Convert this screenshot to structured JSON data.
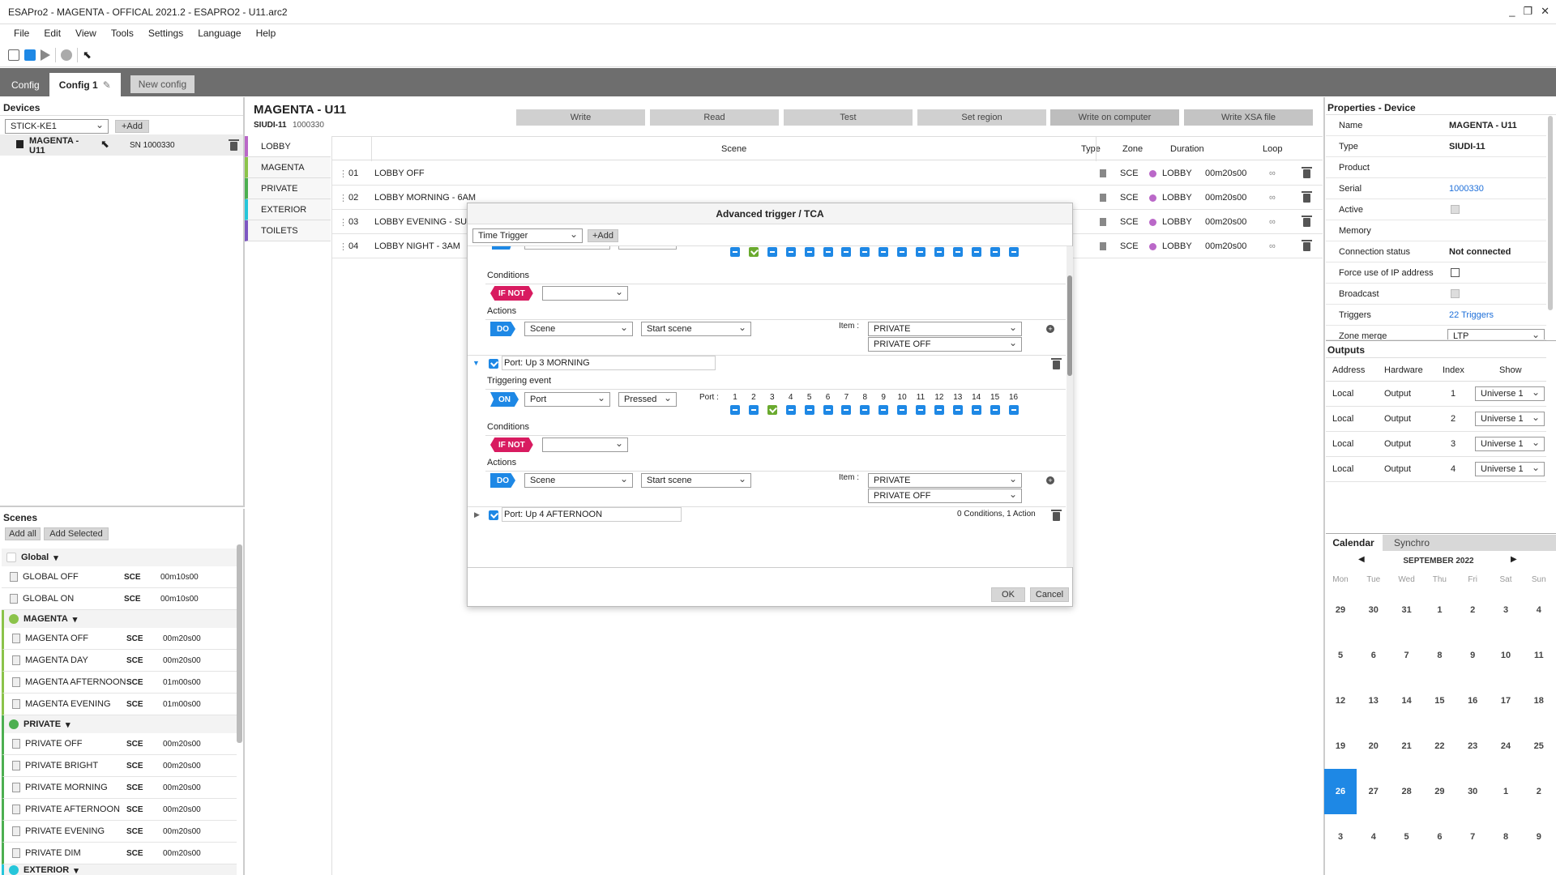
{
  "window": {
    "title": "ESAPro2 - MAGENTA - OFFICAL 2021.2 - ESAPRO2 - U11.arc2",
    "controls": [
      "_",
      "❐",
      "✕"
    ]
  },
  "menu": [
    "File",
    "Edit",
    "View",
    "Tools",
    "Settings",
    "Language",
    "Help"
  ],
  "tabs": {
    "config": "Config",
    "config1": "Config 1",
    "new_config": "New config"
  },
  "devices": {
    "title": "Devices",
    "stick": "STICK-KE1",
    "add": "Add",
    "device": {
      "name_line1": "MAGENTA -",
      "name_line2": "U11",
      "sn": "SN 1000330"
    }
  },
  "scenes": {
    "title": "Scenes",
    "add_all": "Add all",
    "add_selected": "Add Selected",
    "groups": [
      {
        "name": "Global",
        "color": "#ffffff",
        "items": [
          {
            "name": "GLOBAL OFF",
            "type": "SCE",
            "dur": "00m10s00"
          },
          {
            "name": "GLOBAL ON",
            "type": "SCE",
            "dur": "00m10s00"
          }
        ]
      },
      {
        "name": "MAGENTA",
        "color": "#8bc34a",
        "items": [
          {
            "name": "MAGENTA OFF",
            "type": "SCE",
            "dur": "00m20s00"
          },
          {
            "name": "MAGENTA DAY",
            "type": "SCE",
            "dur": "00m20s00"
          },
          {
            "name": "MAGENTA AFTERNOON",
            "type": "SCE",
            "dur": "01m00s00"
          },
          {
            "name": "MAGENTA EVENING",
            "type": "SCE",
            "dur": "01m00s00"
          }
        ]
      },
      {
        "name": "PRIVATE",
        "color": "#4caf50",
        "items": [
          {
            "name": "PRIVATE OFF",
            "type": "SCE",
            "dur": "00m20s00"
          },
          {
            "name": "PRIVATE BRIGHT",
            "type": "SCE",
            "dur": "00m20s00"
          },
          {
            "name": "PRIVATE MORNING",
            "type": "SCE",
            "dur": "00m20s00"
          },
          {
            "name": "PRIVATE AFTERNOON",
            "type": "SCE",
            "dur": "00m20s00"
          },
          {
            "name": "PRIVATE EVENING",
            "type": "SCE",
            "dur": "00m20s00"
          },
          {
            "name": "PRIVATE DIM",
            "type": "SCE",
            "dur": "00m20s00"
          }
        ]
      },
      {
        "name": "EXTERIOR",
        "color": "#26c6da",
        "items": []
      }
    ]
  },
  "device_header": {
    "title": "MAGENTA - U11",
    "model": "SIUDI-11",
    "serial": "1000330"
  },
  "actions": [
    "Write",
    "Read",
    "Test",
    "Set region",
    "Write on computer",
    "Write XSA file"
  ],
  "zones": [
    {
      "name": "LOBBY",
      "color": "#ba68c8"
    },
    {
      "name": "MAGENTA",
      "color": "#8bc34a"
    },
    {
      "name": "PRIVATE",
      "color": "#4caf50"
    },
    {
      "name": "EXTERIOR",
      "color": "#26c6da"
    },
    {
      "name": "TOILETS",
      "color": "#7e57c2"
    }
  ],
  "grid": {
    "headers": {
      "scene": "Scene",
      "type": "Type",
      "zone": "Zone",
      "duration": "Duration",
      "loop": "Loop"
    },
    "rows": [
      {
        "num": "01",
        "name": "LOBBY OFF",
        "type": "SCE",
        "zone": "LOBBY",
        "dur": "00m20s00"
      },
      {
        "num": "02",
        "name": "LOBBY MORNING - 6AM",
        "type": "SCE",
        "zone": "LOBBY",
        "dur": "00m20s00"
      },
      {
        "num": "03",
        "name": "LOBBY EVENING - SUN",
        "type": "SCE",
        "zone": "LOBBY",
        "dur": "00m20s00"
      },
      {
        "num": "04",
        "name": "LOBBY NIGHT - 3AM",
        "type": "SCE",
        "zone": "LOBBY",
        "dur": "00m20s00"
      }
    ]
  },
  "properties": {
    "title": "Properties - Device",
    "rows": [
      {
        "k": "Name",
        "v": "MAGENTA - U11"
      },
      {
        "k": "Type",
        "v": "SIUDI-11"
      },
      {
        "k": "Product",
        "v": ""
      },
      {
        "k": "Serial",
        "v": "1000330"
      },
      {
        "k": "Active",
        "v": ""
      },
      {
        "k": "Memory",
        "v": ""
      },
      {
        "k": "Connection status",
        "v": "Not connected"
      },
      {
        "k": "Force use of IP address",
        "v": ""
      },
      {
        "k": "Broadcast",
        "v": ""
      },
      {
        "k": "Triggers",
        "v": "22 Triggers"
      },
      {
        "k": "Zone merge",
        "v": "LTP"
      }
    ]
  },
  "outputs": {
    "title": "Outputs",
    "headers": [
      "Address",
      "Hardware",
      "Index",
      "Show"
    ],
    "rows": [
      {
        "addr": "Local",
        "hw": "Output",
        "idx": "1",
        "show": "Universe 1"
      },
      {
        "addr": "Local",
        "hw": "Output",
        "idx": "2",
        "show": "Universe 1"
      },
      {
        "addr": "Local",
        "hw": "Output",
        "idx": "3",
        "show": "Universe 1"
      },
      {
        "addr": "Local",
        "hw": "Output",
        "idx": "4",
        "show": "Universe 1"
      }
    ]
  },
  "calendar": {
    "tab_calendar": "Calendar",
    "tab_synchro": "Synchro",
    "month": "SEPTEMBER 2022",
    "weekdays": [
      "Mon",
      "Tue",
      "Wed",
      "Thu",
      "Fri",
      "Sat",
      "Sun"
    ],
    "weeks": [
      [
        "29",
        "30",
        "31",
        "1",
        "2",
        "3",
        "4"
      ],
      [
        "5",
        "6",
        "7",
        "8",
        "9",
        "10",
        "11"
      ],
      [
        "12",
        "13",
        "14",
        "15",
        "16",
        "17",
        "18"
      ],
      [
        "19",
        "20",
        "21",
        "22",
        "23",
        "24",
        "25"
      ],
      [
        "26",
        "27",
        "28",
        "29",
        "30",
        "1",
        "2"
      ],
      [
        "3",
        "4",
        "5",
        "6",
        "7",
        "8",
        "9"
      ]
    ],
    "selected": "26"
  },
  "modal": {
    "title": "Advanced trigger / TCA",
    "trigger_type": "Time Trigger",
    "add": "Add",
    "conditions": "Conditions",
    "actions": "Actions",
    "triggering_event": "Triggering event",
    "if_not": "IF NOT",
    "do": "DO",
    "on": "ON",
    "scene": "Scene",
    "start_scene": "Start scene",
    "item_label": "Item :",
    "item_zone": "PRIVATE",
    "item_off": "PRIVATE OFF",
    "port_sel": "Port",
    "pressed": "Pressed",
    "port_label": "Port :",
    "ports": [
      "1",
      "2",
      "3",
      "4",
      "5",
      "6",
      "7",
      "8",
      "9",
      "10",
      "11",
      "12",
      "13",
      "14",
      "15",
      "16"
    ],
    "trigger2_name": "Port: Up 3 MORNING",
    "trigger3_name": "Port: Up 4 AFTERNOON",
    "trigger3_summary": "0 Conditions, 1 Action",
    "ok": "OK",
    "cancel": "Cancel"
  }
}
